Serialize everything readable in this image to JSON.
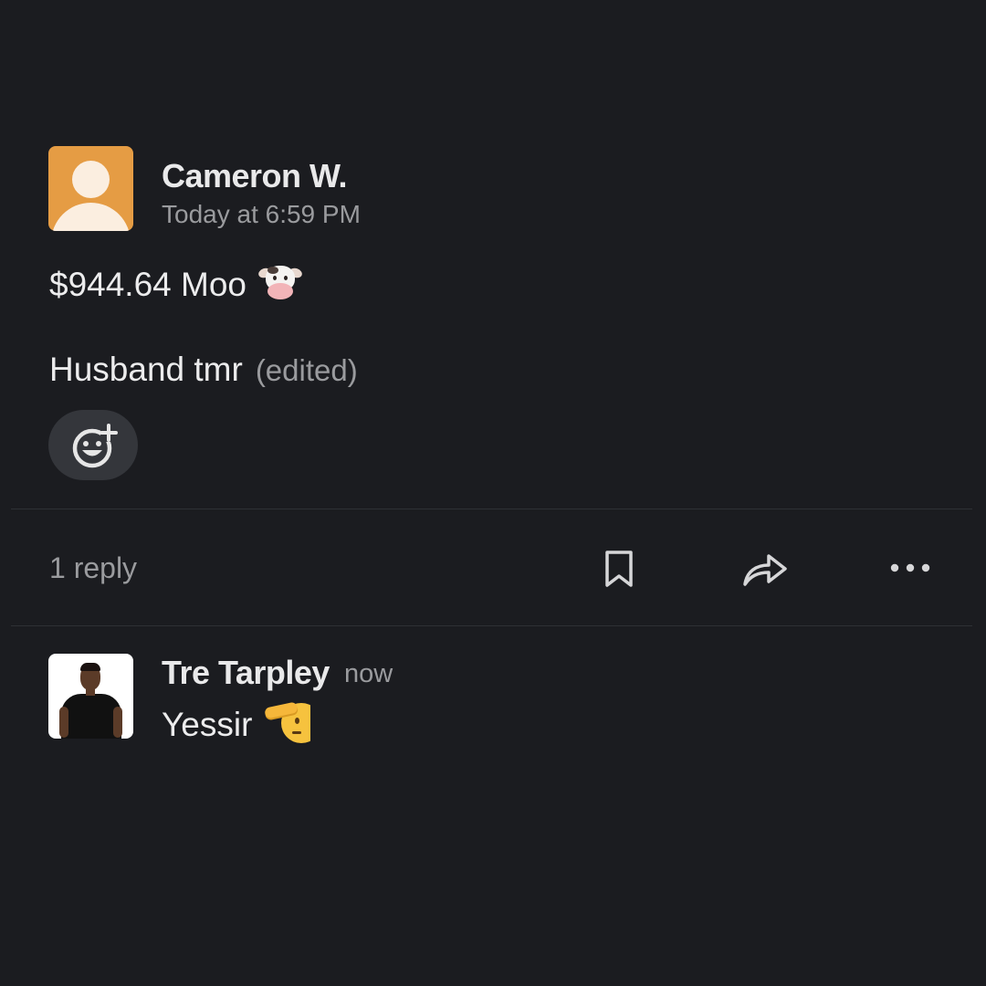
{
  "parent_message": {
    "author": "Cameron W.",
    "timestamp": "Today at 6:59 PM",
    "line1_text": "$944.64 Moo",
    "line1_emoji": "cow-face",
    "line2_text": "Husband tmr",
    "edited_label": "(edited)",
    "add_reaction_icon": "add-reaction-icon"
  },
  "thread_actions": {
    "reply_count": "1 reply",
    "icons": [
      "bookmark-icon",
      "share-icon",
      "more-icon"
    ]
  },
  "reply": {
    "author": "Tre Tarpley",
    "timestamp": "now",
    "text": "Yessir",
    "emoji": "saluting-face"
  },
  "colors": {
    "background": "#1b1c20",
    "avatar_default": "#e59c44",
    "muted_text": "#9a9b9e",
    "primary_text": "#ececed",
    "reaction_pill": "#34363b"
  }
}
